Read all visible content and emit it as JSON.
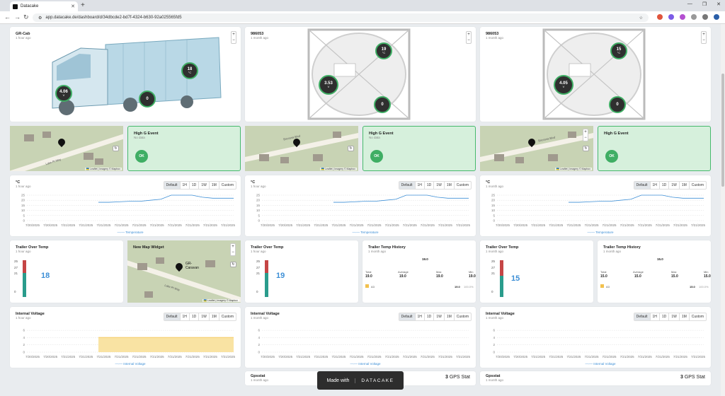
{
  "browser": {
    "tab_title": "Datacake",
    "url": "app.datacake.de/dashboard/d/34dbcde2-bd7f-4324-b630-92a025565fd5"
  },
  "timeframes": [
    "Default",
    "1H",
    "1D",
    "1W",
    "1M",
    "Custom"
  ],
  "asset_cards": [
    {
      "title": "GR-Cab",
      "time": "1 hour ago",
      "badges": [
        {
          "value": "18",
          "unit": "°C"
        },
        {
          "value": "4.06",
          "unit": "V"
        },
        {
          "value": "0",
          "unit": ""
        }
      ]
    },
    {
      "title": "986053",
      "time": "1 month ago",
      "badges": [
        {
          "value": "19",
          "unit": "°C"
        },
        {
          "value": "3.53",
          "unit": "V"
        },
        {
          "value": "0",
          "unit": ""
        }
      ]
    },
    {
      "title": "986053",
      "time": "1 month ago",
      "badges": [
        {
          "value": "15",
          "unit": "°C"
        },
        {
          "value": "4.05",
          "unit": "V"
        },
        {
          "value": "0",
          "unit": ""
        }
      ]
    }
  ],
  "maps": [
    {
      "street": "Lake Pt Way",
      "attribution": "🇺🇦 Leaflet | Imagery © Mapbox"
    },
    {
      "street": "Bocossa Blvd",
      "attribution": "🇺🇦 Leaflet | Imagery © Mapbox"
    },
    {
      "street": "Bocossa Blvd",
      "attribution": "🇺🇦 Leaflet | Imagery © Mapbox"
    }
  ],
  "new_map": {
    "title": "New Map Widget",
    "marker_label": "GR-Caravan",
    "street": "Lake Pt Way",
    "attribution": "🇺🇦 Leaflet | Imagery © Mapbox"
  },
  "gevents": [
    {
      "title": "High G Event",
      "sub": "No data",
      "status": "OK"
    },
    {
      "title": "High G Event",
      "sub": "No data",
      "status": "OK"
    },
    {
      "title": "High G Event",
      "sub": "",
      "status": "OK"
    }
  ],
  "temp_charts": [
    {
      "title": "°C",
      "time": "1 hour ago",
      "legend": "Temperature"
    },
    {
      "title": "°C",
      "time": "1 hour ago",
      "legend": "Temperature"
    },
    {
      "title": "°C",
      "time": "1 month ago",
      "legend": "Temperature"
    }
  ],
  "thermo": [
    {
      "title": "Trailer Over Temp",
      "time": "1 hour ago",
      "value": "18",
      "ticks": [
        "25",
        "27",
        "21",
        "0"
      ]
    },
    {
      "title": "Trailer Over Temp",
      "time": "1 hour ago",
      "value": "19",
      "ticks": [
        "25",
        "27",
        "21",
        "0"
      ]
    },
    {
      "title": "Trailer Over Temp",
      "time": "1 month ago",
      "value": "15",
      "ticks": [
        "25",
        "27",
        "21",
        "0"
      ]
    }
  ],
  "history": [
    {
      "title": "Trailer Temp History",
      "time": "1 month ago",
      "top": "19.0",
      "headers": [
        "Total",
        "Average",
        "Max",
        "Min"
      ],
      "values": [
        "19.0",
        "19.0",
        "19.0",
        "19.0"
      ],
      "item": "A3",
      "item_val": "19.0",
      "item_pct": "100.0%"
    },
    {
      "title": "Trailer Temp History",
      "time": "1 month ago",
      "top": "15.0",
      "headers": [
        "Total",
        "Average",
        "Max",
        "Min"
      ],
      "values": [
        "15.0",
        "15.0",
        "15.0",
        "15.0"
      ],
      "item": "A3",
      "item_val": "15.0",
      "item_pct": "100.0%"
    }
  ],
  "voltage": [
    {
      "title": "Internal Voltage",
      "time": "1 hour ago",
      "legend": "Internal Voltage"
    },
    {
      "title": "Internal Voltage",
      "time": "1 month ago",
      "legend": "Internal Voltage"
    },
    {
      "title": "Internal Voltage",
      "time": "1 month ago",
      "legend": "Internal Voltage"
    }
  ],
  "gps": [
    {
      "title": "Gpsstat",
      "time": "1 month ago",
      "value": "3",
      "label": "GPS Stat"
    },
    {
      "title": "Gpsstat",
      "time": "1 month ago",
      "value": "3",
      "label": "GPS Stat"
    }
  ],
  "made_with": {
    "text": "Made with",
    "brand": "DATACAKE"
  },
  "chart_data": [
    {
      "type": "line",
      "series": [
        {
          "name": "Temperature",
          "values": [
            18,
            18,
            18.5,
            19,
            19,
            20,
            21,
            25,
            25,
            25,
            23,
            22,
            22,
            22
          ]
        }
      ],
      "x": [
        "7/20/2025",
        "7/20/2025",
        "7/21/2025",
        "7/21/2025",
        "7/21/2025",
        "7/21/2025",
        "7/21/2025",
        "7/21/2025",
        "7/21/2025",
        "7/21/2025",
        "7/21/2025",
        "7/21/2025"
      ],
      "yticks": [
        "25",
        "20",
        "15",
        "10",
        "5",
        "0"
      ],
      "ylim": [
        0,
        25
      ]
    },
    {
      "type": "area",
      "series": [
        {
          "name": "Internal Voltage",
          "values": [
            4.06,
            4.06,
            4.06,
            4.06,
            4.06,
            4.06,
            4.06,
            4.06
          ]
        }
      ],
      "x": [
        "7/20/2025",
        "7/20/2025",
        "7/21/2025",
        "7/21/2025",
        "7/21/2025",
        "7/21/2025",
        "7/21/2025",
        "7/21/2025",
        "7/21/2025",
        "7/21/2025",
        "7/21/2025",
        "7/21/2025"
      ],
      "yticks": [
        "6",
        "4",
        "2",
        "0"
      ],
      "ylim": [
        0,
        7
      ]
    }
  ]
}
